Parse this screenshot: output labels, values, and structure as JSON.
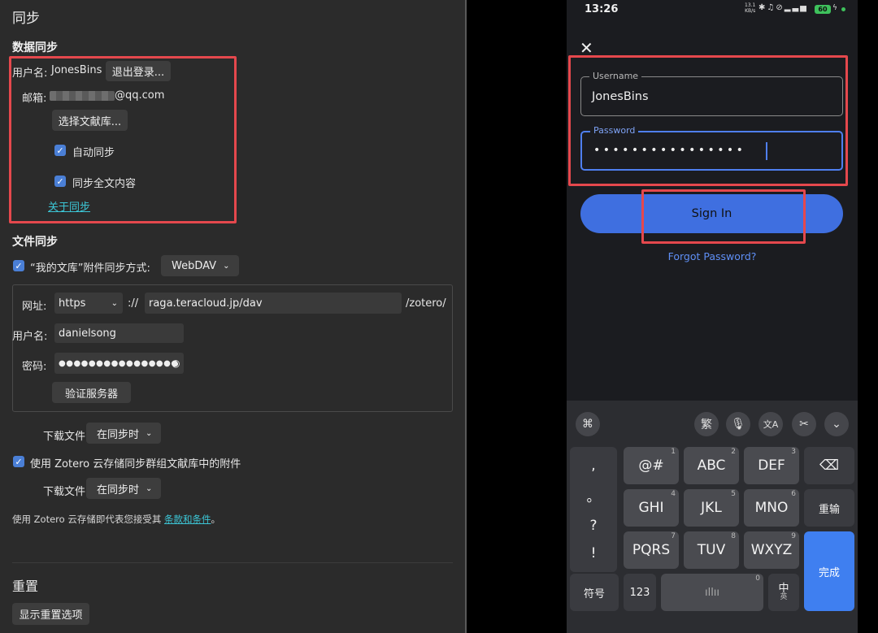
{
  "left": {
    "title": "同步",
    "data_sync": {
      "heading": "数据同步",
      "username_label": "用户名:",
      "username_value": "JonesBins",
      "logout_button": "退出登录...",
      "email_label": "邮箱:",
      "email_suffix": "@qq.com",
      "choose_library_button": "选择文献库...",
      "auto_sync_label": "自动同步",
      "sync_fulltext_label": "同步全文内容",
      "about_sync_link": "关于同步"
    },
    "file_sync": {
      "heading": "文件同步",
      "my_library_label": "“我的文库”附件同步方式:",
      "method_value": "WebDAV",
      "url_label": "网址:",
      "protocol_value": "https",
      "scheme_sep": "://",
      "host_value": "raga.teracloud.jp/dav",
      "path_suffix": "/zotero/",
      "username_label": "用户名:",
      "username_value": "danielsong",
      "password_label": "密码:",
      "password_mask": "●●●●●●●●●●●●●●●●",
      "verify_button": "验证服务器",
      "download_label": "下载文件",
      "download_value": "在同步时",
      "group_label": "使用 Zotero 云存储同步群组文献库中的附件",
      "download_label_2": "下载文件",
      "download_value_2": "在同步时",
      "terms_prefix": "使用 Zotero 云存储即代表您接受其 ",
      "terms_link": "条款和条件",
      "terms_suffix": "。"
    },
    "reset": {
      "heading": "重置",
      "show_reset_button": "显示重置选项"
    }
  },
  "phone": {
    "status_time": "13:26",
    "status_speed_top": "13.1",
    "status_speed_bottom": "KB/s",
    "status_battery": "60",
    "username_label": "Username",
    "username_value": "JonesBins",
    "password_label": "Password",
    "password_mask": "• • • • • • • • • • • • • • • •",
    "sign_in_button": "Sign In",
    "forgot_password_link": "Forgot Password?",
    "keyboard": {
      "toolbar_trad": "繁",
      "punct": [
        ",",
        "。",
        "?",
        "!"
      ],
      "keys": [
        {
          "label": "@#",
          "num": "1"
        },
        {
          "label": "ABC",
          "num": "2"
        },
        {
          "label": "DEF",
          "num": "3"
        },
        {
          "label": "GHI",
          "num": "4"
        },
        {
          "label": "JKL",
          "num": "5"
        },
        {
          "label": "MNO",
          "num": "6"
        },
        {
          "label": "PQRS",
          "num": "7"
        },
        {
          "label": "TUV",
          "num": "8"
        },
        {
          "label": "WXYZ",
          "num": "9"
        }
      ],
      "reenter": "重输",
      "symbols": "符号",
      "num_key": "123",
      "space_num": "0",
      "lang_top": "中",
      "lang_bottom": "英",
      "done": "完成"
    }
  },
  "colors": {
    "accent_blue": "#4a7fd6",
    "highlight_red": "#e5484d",
    "link_cyan": "#3cc6d6",
    "phone_button_blue": "#3f6fe0"
  }
}
